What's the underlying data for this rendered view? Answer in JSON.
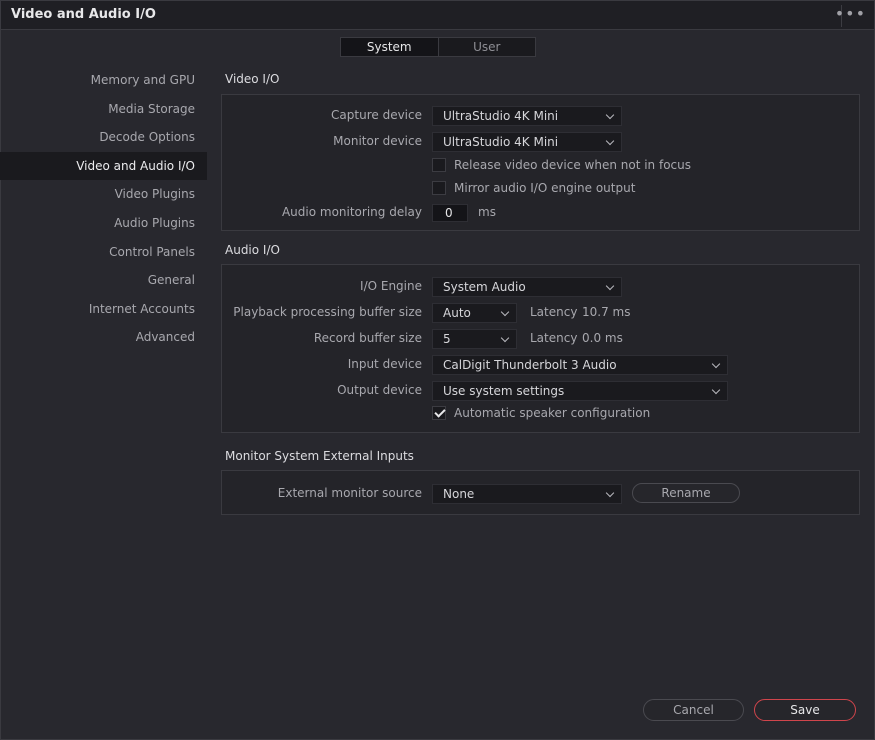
{
  "window": {
    "title": "Video and Audio I/O",
    "more_icon": "more-horizontal-icon"
  },
  "tabs": [
    {
      "label": "System",
      "active": true
    },
    {
      "label": "User",
      "active": false
    }
  ],
  "sidebar": {
    "items": [
      {
        "label": "Memory and GPU"
      },
      {
        "label": "Media Storage"
      },
      {
        "label": "Decode Options"
      },
      {
        "label": "Video and Audio I/O",
        "active": true
      },
      {
        "label": "Video Plugins"
      },
      {
        "label": "Audio Plugins"
      },
      {
        "label": "Control Panels"
      },
      {
        "label": "General"
      },
      {
        "label": "Internet Accounts"
      },
      {
        "label": "Advanced"
      }
    ]
  },
  "video_io": {
    "title": "Video I/O",
    "capture_label": "Capture device",
    "capture_value": "UltraStudio 4K Mini",
    "monitor_label": "Monitor device",
    "monitor_value": "UltraStudio 4K Mini",
    "release_label": "Release video device when not in focus",
    "release_checked": false,
    "mirror_label": "Mirror audio I/O engine output",
    "mirror_checked": false,
    "delay_label": "Audio monitoring delay",
    "delay_value": "0",
    "delay_unit": "ms"
  },
  "audio_io": {
    "title": "Audio I/O",
    "engine_label": "I/O Engine",
    "engine_value": "System Audio",
    "playback_label": "Playback processing buffer size",
    "playback_value": "Auto",
    "playback_latency_label": "Latency",
    "playback_latency_value": "10.7 ms",
    "record_label": "Record buffer size",
    "record_value": "5",
    "record_latency_label": "Latency",
    "record_latency_value": "0.0 ms",
    "input_label": "Input device",
    "input_value": "CalDigit Thunderbolt 3 Audio",
    "output_label": "Output device",
    "output_value": "Use system settings",
    "auto_speaker_label": "Automatic speaker configuration",
    "auto_speaker_checked": true
  },
  "external_inputs": {
    "title": "Monitor System External Inputs",
    "source_label": "External monitor source",
    "source_value": "None",
    "rename_label": "Rename"
  },
  "footer": {
    "cancel_label": "Cancel",
    "save_label": "Save",
    "save_accent": "#d0454c"
  }
}
